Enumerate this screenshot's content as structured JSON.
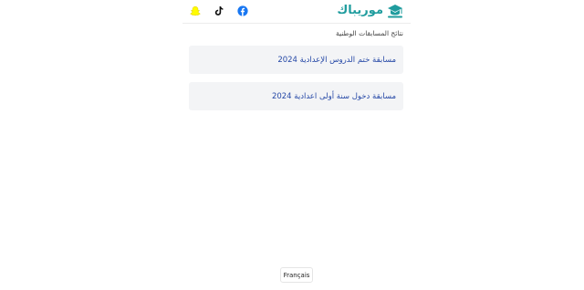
{
  "header": {
    "logo_text": "موريباك",
    "social_icons": [
      "facebook-icon",
      "tiktok-icon",
      "snapchat-icon"
    ]
  },
  "section": {
    "title": "نتائج المسابقات الوطنية"
  },
  "contests": [
    {
      "label": "مسابقة ختم الدروس الإعدادية 2024"
    },
    {
      "label": "مسابقة دخول سنة أولى اعدادية 2024"
    }
  ],
  "footer": {
    "language_button": "Français"
  },
  "colors": {
    "brand": "#1f9c9e",
    "link": "#2447a6",
    "card_bg": "#f3f4f6",
    "facebook": "#1877f2",
    "snapchat": "#fffc00"
  }
}
